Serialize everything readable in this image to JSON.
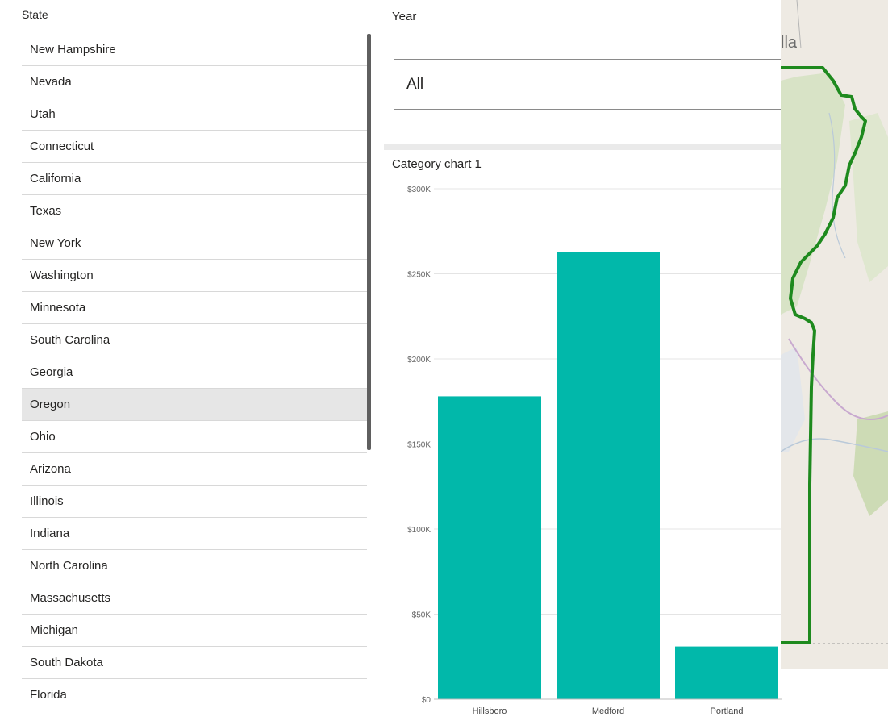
{
  "state_slicer": {
    "title": "State",
    "items": [
      "New Hampshire",
      "Nevada",
      "Utah",
      "Connecticut",
      "California",
      "Texas",
      "New York",
      "Washington",
      "Minnesota",
      "South Carolina",
      "Georgia",
      "Oregon",
      "Ohio",
      "Arizona",
      "Illinois",
      "Indiana",
      "North Carolina",
      "Massachusetts",
      "Michigan",
      "South Dakota",
      "Florida"
    ],
    "selected": "Oregon"
  },
  "year_slicer": {
    "title": "Year",
    "value": "All"
  },
  "map": {
    "label": "lla",
    "boundary_color": "#1e8a1e"
  },
  "chart_data": {
    "type": "bar",
    "title": "Category chart 1",
    "categories": [
      "Hillsboro",
      "Medford",
      "Portland"
    ],
    "values": [
      178000,
      263000,
      31000
    ],
    "ylim": [
      0,
      300000
    ],
    "yticks": [
      0,
      50000,
      100000,
      150000,
      200000,
      250000,
      300000
    ],
    "ytick_labels": [
      "$0",
      "$50K",
      "$100K",
      "$150K",
      "$200K",
      "$250K",
      "$300K"
    ],
    "grid": true,
    "bar_color": "#01b8aa"
  }
}
